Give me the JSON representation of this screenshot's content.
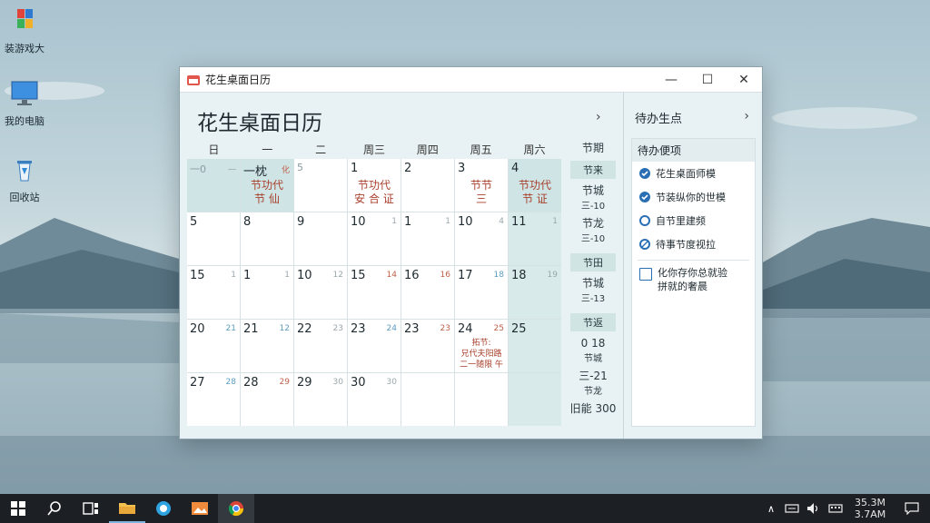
{
  "desktop": {
    "icons": [
      {
        "label": "装游戏大",
        "icon": "app-tiles-icon"
      },
      {
        "label": "我的电脑",
        "icon": "monitor-icon"
      },
      {
        "label": "回收站",
        "icon": "recycle-bin-icon"
      }
    ]
  },
  "window": {
    "title": "花生桌面日历",
    "controls": {
      "minimize": "—",
      "maximize": "☐",
      "close": "✕"
    }
  },
  "calendar": {
    "title": "花生桌面日历",
    "next_symbol": "›",
    "weekdays": [
      "日",
      "一",
      "二",
      "周三",
      "周四",
      "周五",
      "周六"
    ],
    "weeks": [
      [
        {
          "day": "一0",
          "lunar": "一",
          "event": ""
        },
        {
          "day": "一枕",
          "lunar": "化",
          "event": "节功代\n节 仙"
        },
        {
          "day": "5",
          "lunar": "",
          "event": ""
        },
        {
          "day": "1",
          "lunar": "",
          "event": "节功代\n安 合 证"
        },
        {
          "day": "2",
          "lunar": "",
          "event": ""
        },
        {
          "day": "3",
          "lunar": "",
          "event": "节节\n三"
        },
        {
          "day": "4",
          "lunar": "",
          "event": "节功代\n节 证"
        }
      ],
      [
        {
          "day": "5",
          "lunar": "",
          "event": ""
        },
        {
          "day": "8",
          "lunar": "",
          "event": ""
        },
        {
          "day": "9",
          "lunar": "",
          "event": ""
        },
        {
          "day": "10",
          "lunar": "1",
          "event": ""
        },
        {
          "day": "1",
          "lunar": "1",
          "event": ""
        },
        {
          "day": "10",
          "lunar": "4",
          "event": ""
        },
        {
          "day": "11",
          "lunar": "1",
          "event": ""
        }
      ],
      [
        {
          "day": "15",
          "lunar": "1",
          "event": ""
        },
        {
          "day": "1",
          "lunar": "1",
          "event": ""
        },
        {
          "day": "10",
          "lunar": "12",
          "event": ""
        },
        {
          "day": "15",
          "lunar": "14",
          "event": ""
        },
        {
          "day": "16",
          "lunar": "16",
          "event": ""
        },
        {
          "day": "17",
          "lunar": "18",
          "event": ""
        },
        {
          "day": "18",
          "lunar": "19",
          "event": ""
        }
      ],
      [
        {
          "day": "20",
          "lunar": "21",
          "event": ""
        },
        {
          "day": "21",
          "lunar": "12",
          "event": ""
        },
        {
          "day": "22",
          "lunar": "23",
          "event": ""
        },
        {
          "day": "23",
          "lunar": "24",
          "event": ""
        },
        {
          "day": "23",
          "lunar": "23",
          "event": ""
        },
        {
          "day": "24",
          "lunar": "25",
          "event": "拓节:\n兄代夫阳路\n二一随限 午"
        },
        {
          "day": "25",
          "lunar": "",
          "event": ""
        }
      ],
      [
        {
          "day": "27",
          "lunar": "28",
          "event": ""
        },
        {
          "day": "28",
          "lunar": "29",
          "event": ""
        },
        {
          "day": "29",
          "lunar": "30",
          "event": ""
        },
        {
          "day": "30",
          "lunar": "30",
          "event": ""
        },
        {
          "day": "",
          "lunar": "",
          "event": ""
        },
        {
          "day": "",
          "lunar": "",
          "event": ""
        },
        {
          "day": "",
          "lunar": "",
          "event": ""
        }
      ]
    ],
    "side_header": "节期",
    "side": [
      {
        "badge": "节来",
        "lines": [
          "节城",
          "三-10",
          "节龙",
          "三-10"
        ]
      },
      {
        "badge": "节田",
        "lines": [
          "节城",
          "三-13"
        ]
      },
      {
        "badge": "节返",
        "lines": [
          "0 18",
          "节城",
          "三-21",
          "节龙",
          "旧能 300"
        ]
      }
    ]
  },
  "tasks": {
    "header": "待办生点",
    "next_symbol": "›",
    "panel_title": "待办便项",
    "items": [
      {
        "label": "花生桌面师模",
        "state": "done"
      },
      {
        "label": "节装纵你的世模",
        "state": "done"
      },
      {
        "label": "自节里建频",
        "state": "ring"
      },
      {
        "label": "待事节度视拉",
        "state": "edit"
      }
    ],
    "pending": {
      "label": "化你存你总就验\n拼就的奢晨"
    }
  },
  "taskbar": {
    "clock_time": "35.3M",
    "clock_date": "3.7AM",
    "tray_up": "∧"
  }
}
